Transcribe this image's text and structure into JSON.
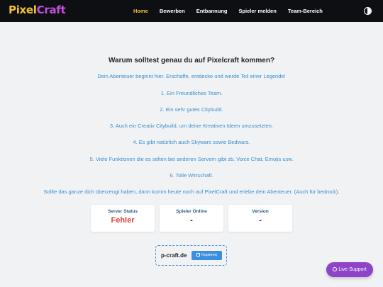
{
  "brand": {
    "part1": "Pixel",
    "part2": "Craft"
  },
  "nav": {
    "items": [
      {
        "label": "Home"
      },
      {
        "label": "Bewerben"
      },
      {
        "label": "Entbannung"
      },
      {
        "label": "Spieler melden"
      },
      {
        "label": "Team-Bereich"
      }
    ]
  },
  "hero": {
    "title": "Warum solltest genau du auf Pixelcraft kommen?",
    "lines": [
      "Dein Abenteuer beginnt hier. Erschaffe, entdecke und werde Teil einer Legende!",
      "1. Ein Freundliches Team.",
      "2. Ein sehr gutes Citybuild.",
      "3. Auch ein Creativ Citybuild, um deine Kreativen Ideen umzusetzten.",
      "4. Es gibt natürlich auch Skywars sowie Bedwars.",
      "5. Viele Funktionen die es selten bei anderen Servern gibt zb. Voice Chat, Emojis usw.",
      "6. Tolle Wirtschaft.",
      "Sollte das ganze dich überzeugt haben, dann komm heute noch auf PixelCraft und erlebe dein Abenteuer. (Auch für bedrock)."
    ]
  },
  "stats": {
    "server_status": {
      "label": "Server Status",
      "value": "Fehler"
    },
    "players_online": {
      "label": "Spieler Online",
      "value": "-"
    },
    "version": {
      "label": "Version",
      "value": "-"
    }
  },
  "server_ip": {
    "address": "p-craft.de",
    "copy_label": "Kopieren"
  },
  "support": {
    "label": "Live Support"
  },
  "icons": {
    "theme": "theme-toggle-icon",
    "copy": "copy-icon",
    "support": "chat-icon"
  },
  "colors": {
    "accent_yellow": "#f2c230",
    "accent_purple": "#c54ee0",
    "link_blue": "#3a8fcf",
    "error_red": "#e0403a",
    "support_purple": "#8e44c8"
  }
}
